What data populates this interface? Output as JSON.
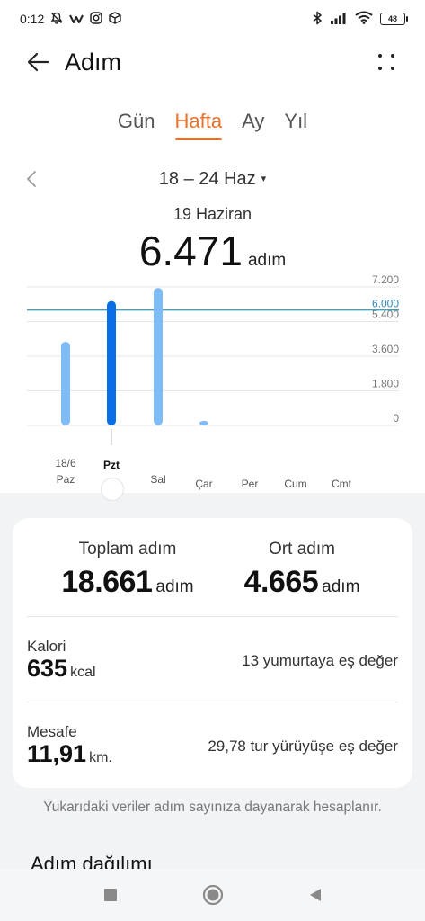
{
  "status_bar": {
    "time": "0:12",
    "battery": "48",
    "icons": [
      "bell-off-icon",
      "app-icon",
      "instagram-icon",
      "box-icon",
      "bluetooth-icon",
      "signal-icon",
      "wifi-icon",
      "battery-icon"
    ]
  },
  "header": {
    "title": "Adım",
    "back_icon": "arrow-left-icon",
    "more_icon": "more-icon"
  },
  "tabs": [
    {
      "label": "Gün",
      "active": false
    },
    {
      "label": "Hafta",
      "active": true
    },
    {
      "label": "Ay",
      "active": false
    },
    {
      "label": "Yıl",
      "active": false
    }
  ],
  "range": {
    "label": "18 – 24 Haz",
    "caret": "▾",
    "prev": "‹"
  },
  "selected": {
    "date": "19 Haziran",
    "value": "6.471",
    "unit": "adım"
  },
  "chart_data": {
    "type": "bar",
    "categories": [
      "Paz",
      "Pzt",
      "Sal",
      "Çar",
      "Per",
      "Cum",
      "Cmt"
    ],
    "date_labels": [
      "18/6",
      "",
      "",
      "",
      "",
      "",
      ""
    ],
    "values": [
      4350,
      6471,
      7150,
      240,
      0,
      0,
      0
    ],
    "selected_index": 1,
    "ylim": [
      0,
      7200
    ],
    "y_ticks": [
      {
        "value": 0,
        "label": "0"
      },
      {
        "value": 1800,
        "label": "1.800"
      },
      {
        "value": 3600,
        "label": "3.600"
      },
      {
        "value": 5400,
        "label": "5.400"
      },
      {
        "value": 7200,
        "label": "7.200"
      }
    ],
    "goal": {
      "value": 6000,
      "label": "6.000"
    },
    "colors": {
      "bar": "#7fbcf6",
      "selected_bar": "#0a6fe6",
      "goal_line": "#4f9bb3",
      "goal_label": "#2f86b8",
      "grid": "#e6e6e6"
    }
  },
  "summary": {
    "total": {
      "label": "Toplam adım",
      "value": "18.661",
      "unit": "adım"
    },
    "average": {
      "label": "Ort adım",
      "value": "4.665",
      "unit": "adım"
    },
    "calories": {
      "label": "Kalori",
      "value": "635",
      "unit": "kcal",
      "equivalent": "13 yumurtaya eş değer"
    },
    "distance": {
      "label": "Mesafe",
      "value": "11,91",
      "unit": "km.",
      "equivalent": "29,78 tur yürüyüşe eş değer"
    }
  },
  "footnote": "Yukarıdaki veriler adım sayınıza dayanarak hesaplanır.",
  "section_title": "Adım dağılımı",
  "nav": [
    "recents-button",
    "home-button",
    "back-button"
  ]
}
